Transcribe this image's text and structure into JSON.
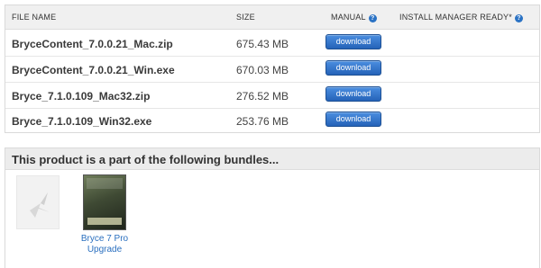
{
  "files_table": {
    "headers": {
      "file_name": "FILE NAME",
      "size": "SIZE",
      "manual": "MANUAL",
      "install_manager": "INSTALL MANAGER READY*"
    },
    "help_icon_glyph": "?",
    "rows": [
      {
        "name": "BryceContent_7.0.0.21_Mac.zip",
        "size": "675.43 MB",
        "button": "download"
      },
      {
        "name": "BryceContent_7.0.0.21_Win.exe",
        "size": "670.03 MB",
        "button": "download"
      },
      {
        "name": "Bryce_7.1.0.109_Mac32.zip",
        "size": "276.52 MB",
        "button": "download"
      },
      {
        "name": "Bryce_7.1.0.109_Win32.exe",
        "size": "253.76 MB",
        "button": "download"
      }
    ]
  },
  "bundles": {
    "title": "This product is a part of the following bundles...",
    "items": [
      {
        "name": "Bryce 7 Pro Upgrade"
      }
    ]
  },
  "colors": {
    "accent_blue": "#2a72c4",
    "link_blue": "#2a6fbf",
    "header_bg": "#f0f0f0"
  }
}
